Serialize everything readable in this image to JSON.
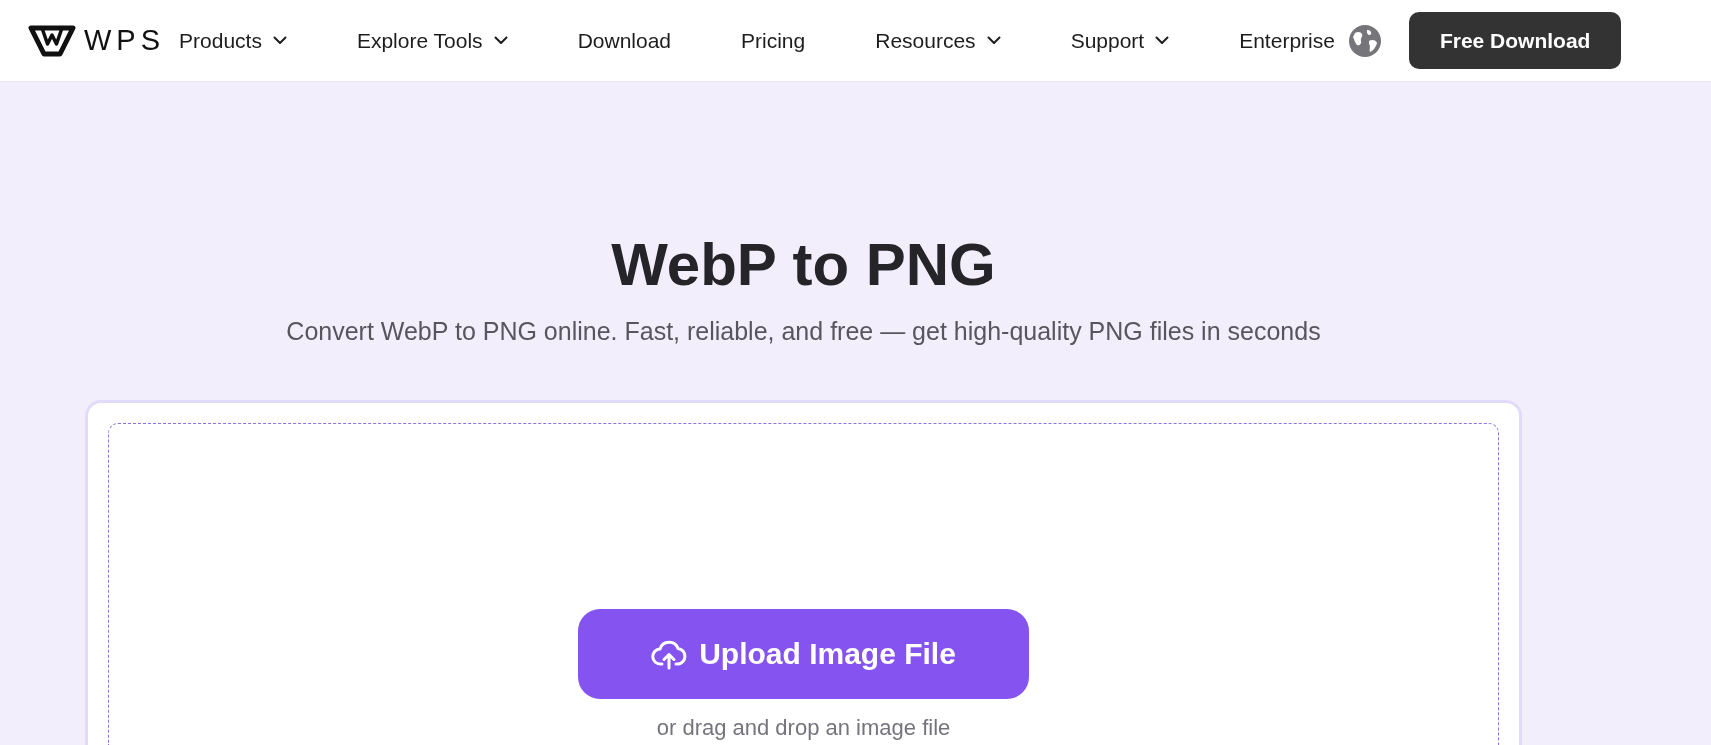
{
  "header": {
    "logo": {
      "text": "WPS"
    },
    "nav": [
      {
        "label": "Products",
        "kind": "dropdown"
      },
      {
        "label": "Explore Tools",
        "kind": "dropdown"
      },
      {
        "label": "Download",
        "kind": "link"
      },
      {
        "label": "Pricing",
        "kind": "link"
      },
      {
        "label": "Resources",
        "kind": "dropdown"
      },
      {
        "label": "Support",
        "kind": "dropdown"
      },
      {
        "label": "Enterprise",
        "kind": "link"
      }
    ],
    "cta": "Free Download"
  },
  "hero": {
    "title": "WebP to PNG",
    "subtitle": "Convert WebP to PNG online. Fast, reliable, and free — get high-quality PNG files in seconds"
  },
  "upload": {
    "button": "Upload Image File",
    "hint": "or drag and drop an image file"
  }
}
